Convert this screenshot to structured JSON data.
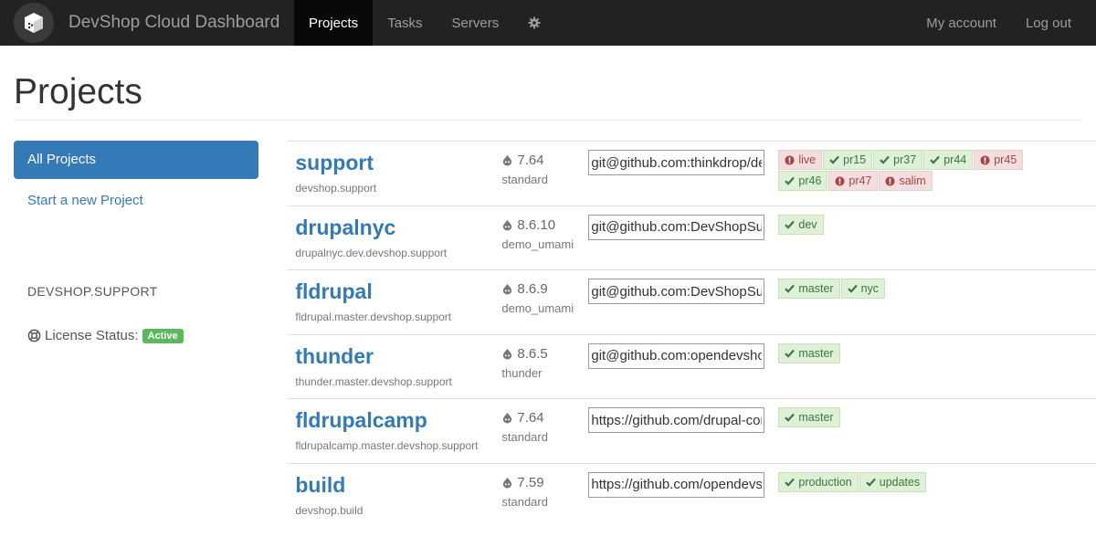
{
  "nav": {
    "brand_title": "DevShop Cloud Dashboard",
    "items": [
      "Projects",
      "Tasks",
      "Servers"
    ],
    "settings_icon": "gear-icon",
    "right": [
      "My account",
      "Log out"
    ]
  },
  "page": {
    "title": "Projects"
  },
  "sidebar": {
    "links": [
      "All Projects",
      "Start a new Project"
    ],
    "host": "DEVSHOP.SUPPORT",
    "license_label": "License Status:",
    "license_badge": "Active"
  },
  "colors": {
    "success": "#5cb85c",
    "danger": "#a94442",
    "link": "#337ab7",
    "navbar": "#222222"
  },
  "projects": [
    {
      "name": "support",
      "host": "devshop.support",
      "version": "7.64",
      "profile": "standard",
      "repo": "git@github.com:thinkdrop/devshop.support.git",
      "envs": [
        {
          "name": "live",
          "status": "error"
        },
        {
          "name": "pr15",
          "status": "ok"
        },
        {
          "name": "pr37",
          "status": "ok"
        },
        {
          "name": "pr44",
          "status": "ok"
        },
        {
          "name": "pr45",
          "status": "error"
        },
        {
          "name": "pr46",
          "status": "ok"
        },
        {
          "name": "pr47",
          "status": "error"
        },
        {
          "name": "salim",
          "status": "error"
        }
      ]
    },
    {
      "name": "drupalnyc",
      "host": "drupalnyc.dev.devshop.support",
      "version": "8.6.10",
      "profile": "demo_umami",
      "repo": "git@github.com:DevShopSupport/drupalnyc.git",
      "envs": [
        {
          "name": "dev",
          "status": "ok"
        }
      ]
    },
    {
      "name": "fldrupal",
      "host": "fldrupal.master.devshop.support",
      "version": "8.6.9",
      "profile": "demo_umami",
      "repo": "git@github.com:DevShopSupport/fldrupal.git",
      "envs": [
        {
          "name": "master",
          "status": "ok"
        },
        {
          "name": "nyc",
          "status": "ok"
        }
      ]
    },
    {
      "name": "thunder",
      "host": "thunder.master.devshop.support",
      "version": "8.6.5",
      "profile": "thunder",
      "repo": "git@github.com:opendevshop/thunder.git",
      "envs": [
        {
          "name": "master",
          "status": "ok"
        }
      ]
    },
    {
      "name": "fldrupalcamp",
      "host": "fldrupalcamp.master.devshop.support",
      "version": "7.64",
      "profile": "standard",
      "repo": "https://github.com/drupal-composer/drupal-project.git",
      "envs": [
        {
          "name": "master",
          "status": "ok"
        }
      ]
    },
    {
      "name": "build",
      "host": "devshop.build",
      "version": "7.59",
      "profile": "standard",
      "repo": "https://github.com/opendevshop/devshop.git",
      "envs": [
        {
          "name": "production",
          "status": "ok"
        },
        {
          "name": "updates",
          "status": "ok"
        }
      ]
    }
  ]
}
